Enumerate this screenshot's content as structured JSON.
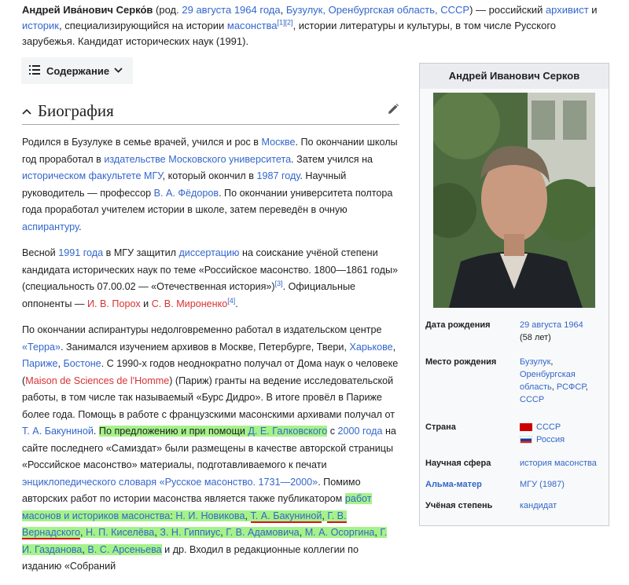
{
  "intro": {
    "name": "Андрей Ива́нович Серко́в",
    "p1": " (род. ",
    "birth_link": "29 августа 1964 года",
    "p2": ", ",
    "place_link": "Бузулук, Оренбургская область, СССР",
    "p3": ") — российский ",
    "archivist_link": "архивист",
    "p4": " и ",
    "historian_link": "историк",
    "p5": ", специализирующийся на истории ",
    "masonry_link": "масонства",
    "refs": "[1][2]",
    "p6": ", истории литературы и культуры, в том числе Русского зарубежья. Кандидат исторических наук (1991)."
  },
  "toc": {
    "label": "Содержание"
  },
  "heading": {
    "title": "Биография"
  },
  "bio": {
    "para1": {
      "t1": "Родился в Бузулуке в семье врачей, учился и рос в ",
      "moscow": "Москве",
      "t2": ". По окончании школы год проработал в ",
      "mu_press": "издательстве Московского университета",
      "t3": ". Затем учился на ",
      "hist_fac": "историческом факультете МГУ",
      "t4": ", который окончил в ",
      "y1987": "1987 году",
      "t5": ". Научный руководитель — профессор ",
      "fedorov": "В. А. Фёдоров",
      "t6": ". По окончании университета полтора года проработал учителем истории в школе, затем переведён в очную ",
      "asp": "аспирантуру",
      "t7": "."
    },
    "para2": {
      "t1": "Весной ",
      "y1991": "1991 года",
      "t2": " в МГУ защитил ",
      "diss": "диссертацию",
      "t3": " на соискание учёной степени кандидата исторических наук по теме «Российское масонство. 1800—1861 годы» (специальность 07.00.02 — «Отечественная история»)",
      "ref3": "[3]",
      "t4": ". Официальные оппоненты — ",
      "porokh": "И. В. Порох",
      "t5": " и ",
      "mironenko": "С. В. Мироненко",
      "ref4": "[4]",
      "t6": "."
    },
    "para3": {
      "t1": "По окончании аспирантуры недолговременно работал в издательском центре ",
      "terra": "«Терра»",
      "t2": ". Занимался изучением архивов в Москве, Петербурге, Твери, ",
      "kharkov": "Харькове",
      "t3": ", ",
      "paris": "Париже",
      "t4": ", ",
      "boston": "Бостоне",
      "t5": ". С 1990-х годов неоднократно получал от Дома наук о человеке (",
      "msh": "Maison de Sciences de l'Homme",
      "t6": ") (Париж) гранты на ведение исследовательской работы, в том числе так называемый «Бурс Дидро». В итоге провёл в Париже более года. Помощь в работе с французскими масонскими архивами получал от ",
      "bakunina": "Т. А. Бакуниной",
      "t7": ". ",
      "h1": "По предложению и при помощи ",
      "galkovsky": "Д. Е. Галковского",
      "t8": " с ",
      "y2000": "2000 года",
      "t9": " на сайте последнего «Самиздат» были размещены в качестве авторской страницы «Российское масонство» материалы, подготавливаемого к печати ",
      "encyc": "энциклопедического словаря «Русское масонство. 1731—2000»",
      "t10": ". Помимо авторских работ по истории масонства является также публикатором ",
      "works": "работ масонов и историков масонства",
      "t11": ": ",
      "novikova": "Н. И. Новикова",
      "c1": ", ",
      "bakunina2": "Т. А. Бакуниной",
      "c2": ", ",
      "vernadsky": "Г. В. Вернадского",
      "c3": ", ",
      "kiseleva": "Н. П. Киселёва",
      "c4": ", ",
      "gippius": "З. Н. Гиппиус",
      "c5": ", ",
      "adamovich": "Г. В. Адамовича",
      "c6": ", ",
      "osorgin": "М. А. Осоргина",
      "c7": ", ",
      "gazdanov": "Г. И. Газданова",
      "c8": ", ",
      "arsenyeva": "В. С. Арсеньева",
      "t12": " и др. Входил в редакционные коллегии по изданию «Собраний"
    }
  },
  "infobox": {
    "title": "Андрей Иванович Серков",
    "rows": {
      "birth": {
        "label": "Дата рождения",
        "link": "29 августа 1964",
        "age": "(58 лет)"
      },
      "birthplace": {
        "label": "Место рождения",
        "l1": "Бузулук",
        "l2": "Оренбургская область",
        "l3": "РСФСР",
        "l4": "СССР"
      },
      "country": {
        "label": "Страна",
        "c1": "СССР",
        "c2": "Россия"
      },
      "field": {
        "label": "Научная сфера",
        "value": "история масонства"
      },
      "alma": {
        "label": "Альма-матер",
        "value": "МГУ (1987)"
      },
      "degree": {
        "label": "Учёная степень",
        "value": "кандидат"
      }
    }
  },
  "colors": {
    "link": "#3366cc",
    "redlink": "#d73333",
    "highlight": "#a6f28a",
    "underline": "#e01010"
  }
}
